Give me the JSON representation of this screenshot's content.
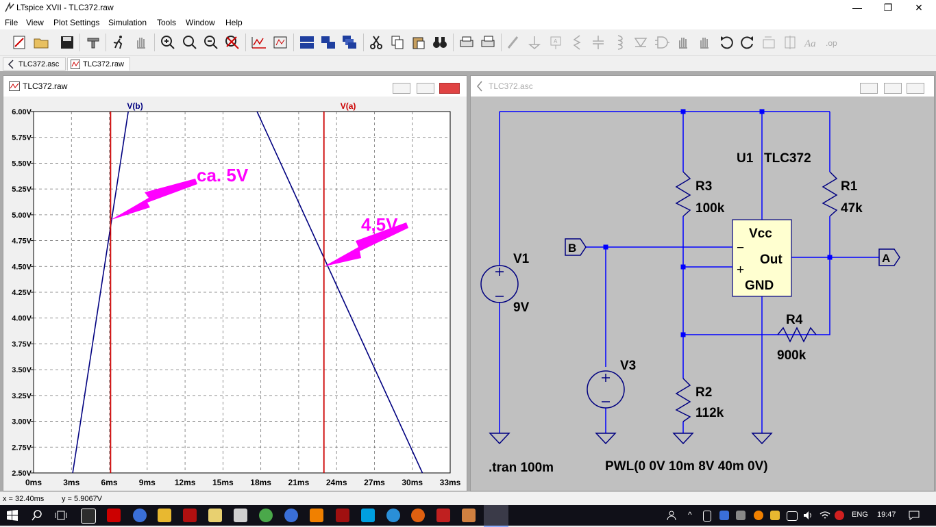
{
  "window": {
    "title": "LTspice XVII - TLC372.raw",
    "minimize": "—",
    "maximize": "❐",
    "close": "✕"
  },
  "menu": [
    "File",
    "View",
    "Plot Settings",
    "Simulation",
    "Tools",
    "Window",
    "Help"
  ],
  "tabs": [
    {
      "label": "TLC372.asc"
    },
    {
      "label": "TLC372.raw"
    }
  ],
  "plot_window": {
    "title": "TLC372.raw"
  },
  "schematic_window": {
    "title": "TLC372.asc"
  },
  "chart_data": {
    "type": "line",
    "xlabel": "",
    "ylabel": "",
    "xlim": [
      0,
      33
    ],
    "ylim": [
      2.5,
      6.0
    ],
    "x_ticks": [
      "0ms",
      "3ms",
      "6ms",
      "9ms",
      "12ms",
      "15ms",
      "18ms",
      "21ms",
      "24ms",
      "27ms",
      "30ms",
      "33ms"
    ],
    "y_ticks": [
      "2.50V",
      "2.75V",
      "3.00V",
      "3.25V",
      "3.50V",
      "3.75V",
      "4.00V",
      "4.25V",
      "4.50V",
      "4.75V",
      "5.00V",
      "5.25V",
      "5.50V",
      "5.75V",
      "6.00V"
    ],
    "grid": true,
    "series": [
      {
        "name": "V(b)",
        "color": "#000080",
        "x": [
          3.1,
          7.5
        ],
        "y": [
          2.5,
          6.0
        ]
      },
      {
        "name": "V(b)",
        "color": "#000080",
        "x": [
          17.7,
          30.8
        ],
        "y": [
          6.0,
          2.5
        ]
      }
    ],
    "cursors": [
      {
        "label": "V(b)",
        "x": 6.1,
        "color": "#cc0000"
      },
      {
        "label": "V(a)",
        "x": 23.0,
        "color": "#cc0000"
      }
    ],
    "annotations": [
      {
        "text": "ca. 5V",
        "color": "#ff00ff"
      },
      {
        "text": "4,5V",
        "color": "#ff00ff"
      }
    ]
  },
  "schematic": {
    "labels": {
      "u1": "U1",
      "part": "TLC372",
      "r3": "R3",
      "r3v": "100k",
      "r1": "R1",
      "r1v": "47k",
      "r4": "R4",
      "r4v": "900k",
      "r2": "R2",
      "r2v": "112k",
      "v1": "V1",
      "v1v": "9V",
      "v3": "V3",
      "vcc": "Vcc",
      "out": "Out",
      "gnd": "GND",
      "in_minus": "−",
      "in_plus": "+",
      "netB": "B",
      "netA": "A",
      "tran": ".tran 100m",
      "pwl": "PWL(0 0V 10m 8V 40m 0V)"
    }
  },
  "status": {
    "x": "x = 32.40ms",
    "y": "y = 5.9067V"
  },
  "taskbar": {
    "lang": "ENG",
    "time": "19:47"
  },
  "colors": {
    "wire": "#0000ff",
    "cursor": "#cc0000",
    "trace": "#000080",
    "annotation": "#ff00ff"
  }
}
